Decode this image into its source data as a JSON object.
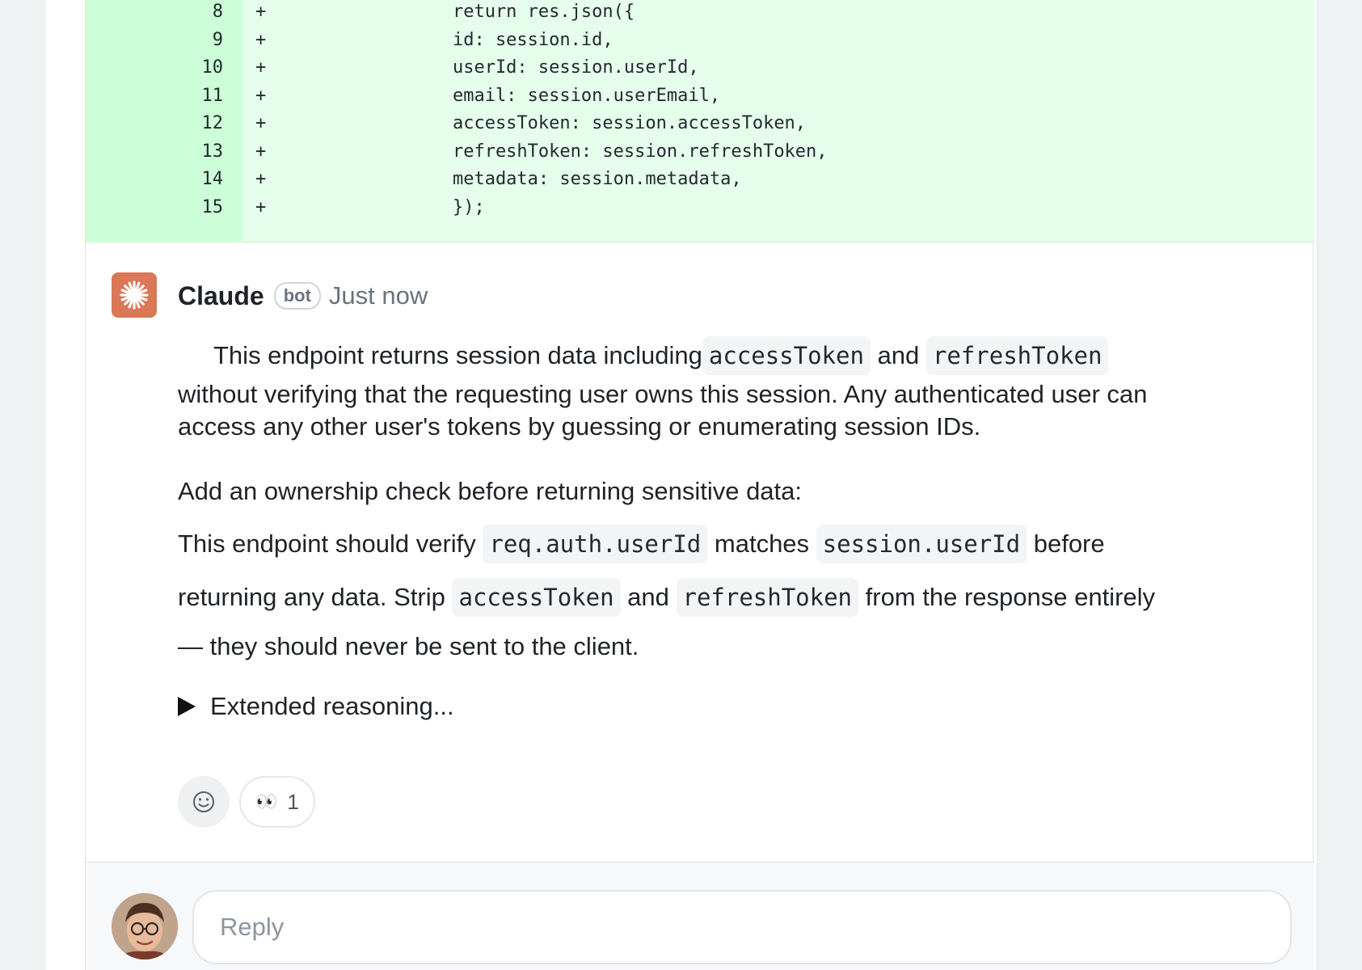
{
  "diff": {
    "lines": [
      {
        "num": "8",
        "sign": "+",
        "code": "        return res.json({"
      },
      {
        "num": "9",
        "sign": "+",
        "code": "        id: session.id,"
      },
      {
        "num": "10",
        "sign": "+",
        "code": "        userId: session.userId,"
      },
      {
        "num": "11",
        "sign": "+",
        "code": "        email: session.userEmail,"
      },
      {
        "num": "12",
        "sign": "+",
        "code": "        accessToken: session.accessToken,"
      },
      {
        "num": "13",
        "sign": "+",
        "code": "        refreshToken: session.refreshToken,"
      },
      {
        "num": "14",
        "sign": "+",
        "code": "        metadata: session.metadata,"
      },
      {
        "num": "15",
        "sign": "+",
        "code": "        });"
      }
    ]
  },
  "comment": {
    "author": "Claude",
    "badge": "bot",
    "timestamp": "Just now",
    "p1": {
      "t1": "This endpoint returns session data including ",
      "c1": "accessToken",
      "t2": " and ",
      "c2": "refreshToken"
    },
    "p1_rest": "without verifying that the requesting user owns this session. Any authenticated user can access any other user's tokens by guessing or enumerating session IDs.",
    "p2": "Add an ownership check before returning sensitive data:",
    "p3": {
      "t1": "This endpoint should verify ",
      "c1": "req.auth.userId",
      "t2": " matches ",
      "c2": "session.userId",
      "t3": " before",
      "t4": "returning any data. Strip ",
      "c3": "accessToken",
      "t5": " and ",
      "c4": "refreshToken",
      "t6": " from the response entirely",
      "t7": "— they should never be sent to the client."
    },
    "reasoning_label": "Extended reasoning...",
    "reactions": [
      {
        "emoji": "👀",
        "count": "1"
      }
    ]
  },
  "reply": {
    "placeholder": "Reply"
  },
  "colors": {
    "diff_bg": "#e6ffec",
    "diff_gutter": "#ccffd8",
    "claude_brand": "#d97757"
  },
  "icons": {
    "claude_logo": "claude-asterisk-icon",
    "add_reaction": "smiley-icon",
    "disclosure": "triangle-right-icon"
  }
}
